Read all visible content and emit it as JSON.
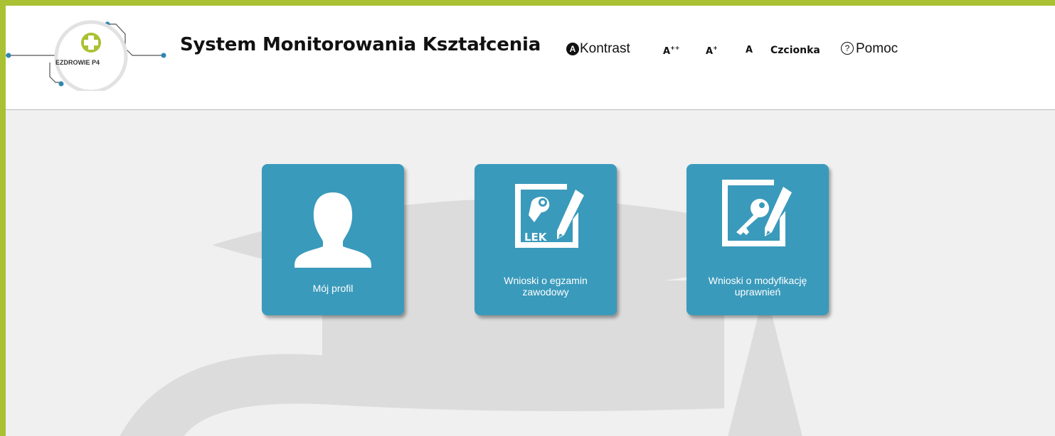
{
  "header": {
    "logo_text": "EZDROWIE P4",
    "app_title": "System Monitorowania Kształcenia",
    "kontrast_icon": "A",
    "kontrast_label": "Kontrast",
    "font_size_large": "A",
    "font_size_large_mark": "++",
    "font_size_medium": "A",
    "font_size_medium_mark": "+",
    "font_size_normal": "A",
    "czcionka_label": "Czcionka",
    "pomoc_icon": "?",
    "pomoc_label": "Pomoc"
  },
  "tiles": [
    {
      "label": "Mój profil",
      "icon": "user-silhouette-icon"
    },
    {
      "label": "Wnioski o egzamin zawodowy",
      "icon": "exam-application-icon",
      "badge": "LEK"
    },
    {
      "label": "Wnioski o modyfikację uprawnień",
      "icon": "permissions-key-icon"
    }
  ],
  "colors": {
    "border": "#a9c132",
    "tile": "#3a9abb",
    "background": "#f0f0f0",
    "watermark": "#dcdcdc",
    "logo_accent": "#a9c132",
    "logo_dots": "#2f87b0"
  }
}
